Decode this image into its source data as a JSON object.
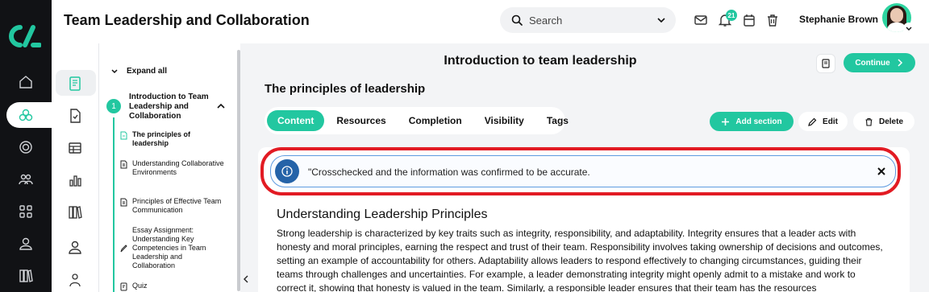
{
  "header": {
    "course_title": "Team Leadership and Collaboration",
    "search_placeholder": "Search",
    "notification_count": "21",
    "user_name": "Stephanie Brown"
  },
  "tree": {
    "expand_all": "Expand all",
    "module_number": "1",
    "module_title": "Introduction to Team Leadership and Collaboration",
    "lessons": [
      {
        "label": "The principles of leadership",
        "icon": "page-icon",
        "active": true
      },
      {
        "label": "Understanding Collaborative Environments",
        "icon": "document-icon"
      },
      {
        "label": "Principles of Effective Team Communication",
        "icon": "document-icon"
      },
      {
        "label": "Essay Assignment: Understanding Key Competencies in Team Leadership and Collaboration",
        "icon": "pencil-icon"
      },
      {
        "label": "Quiz",
        "icon": "quiz-icon"
      }
    ]
  },
  "main": {
    "lesson_title": "Introduction to team leadership",
    "continue_label": "Continue",
    "section_title": "The principles of leadership",
    "tabs": [
      "Content",
      "Resources",
      "Completion",
      "Visibility",
      "Tags"
    ],
    "add_section_label": "Add section",
    "edit_label": "Edit",
    "delete_label": "Delete",
    "alert_text": "\"Crosschecked and the information was confirmed to be accurate.",
    "content_heading": "Understanding Leadership Principles",
    "content_body": "Strong leadership is characterized by key traits such as integrity, responsibility, and adaptability. Integrity ensures that a leader acts with honesty and moral principles, earning the respect and trust of their team. Responsibility involves taking ownership of decisions and outcomes, setting an example of accountability for others. Adaptability allows leaders to respond effectively to changing circumstances, guiding their teams through challenges and uncertainties. For example, a leader demonstrating integrity might openly admit to a mistake and work to correct it, showing that honesty is valued in the team. Similarly, a responsible leader ensures that their team has the resources"
  },
  "colors": {
    "accent": "#22c7a0",
    "rail": "#111215",
    "highlight": "#e21b23",
    "info": "#2563a8"
  }
}
